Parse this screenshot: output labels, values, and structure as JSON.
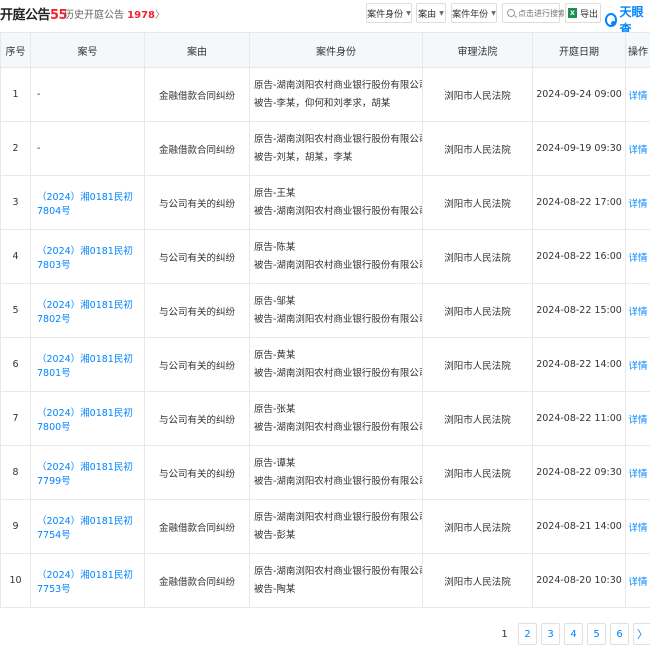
{
  "header": {
    "title": "开庭公告",
    "title_count": "55",
    "history_label": "历史开庭公告",
    "history_count": "1978",
    "history_arrow": "〉"
  },
  "filters": {
    "case_role": "案件身份",
    "cause": "案由",
    "year": "案件年份",
    "search_placeholder": "点击进行搜索",
    "export_label": "导出",
    "brand": "天眼查"
  },
  "table": {
    "columns": [
      "序号",
      "案号",
      "案由",
      "案件身份",
      "审理法院",
      "开庭日期",
      "操作"
    ],
    "rows": [
      {
        "no": "1",
        "case": "-",
        "cause": "金融借款合同纠纷",
        "plaintiff": "原告-湖南浏阳农村商业银行股份有限公司",
        "defendant": "被告-李某，仰何和刘孝求，胡某",
        "court": "浏阳市人民法院",
        "date": "2024-09-24 09:00",
        "action": "详情"
      },
      {
        "no": "2",
        "case": "-",
        "cause": "金融借款合同纠纷",
        "plaintiff": "原告-湖南浏阳农村商业银行股份有限公司",
        "defendant": "被告-刘某，胡某，李某",
        "court": "浏阳市人民法院",
        "date": "2024-09-19 09:30",
        "action": "详情"
      },
      {
        "no": "3",
        "case": "（2024）湘0181民初7804号",
        "cause": "与公司有关的纠纷",
        "plaintiff": "原告-王某",
        "defendant": "被告-湖南浏阳农村商业银行股份有限公司",
        "court": "浏阳市人民法院",
        "date": "2024-08-22 17:00",
        "action": "详情"
      },
      {
        "no": "4",
        "case": "（2024）湘0181民初7803号",
        "cause": "与公司有关的纠纷",
        "plaintiff": "原告-陈某",
        "defendant": "被告-湖南浏阳农村商业银行股份有限公司",
        "court": "浏阳市人民法院",
        "date": "2024-08-22 16:00",
        "action": "详情"
      },
      {
        "no": "5",
        "case": "（2024）湘0181民初7802号",
        "cause": "与公司有关的纠纷",
        "plaintiff": "原告-邹某",
        "defendant": "被告-湖南浏阳农村商业银行股份有限公司",
        "court": "浏阳市人民法院",
        "date": "2024-08-22 15:00",
        "action": "详情"
      },
      {
        "no": "6",
        "case": "（2024）湘0181民初7801号",
        "cause": "与公司有关的纠纷",
        "plaintiff": "原告-黄某",
        "defendant": "被告-湖南浏阳农村商业银行股份有限公司",
        "court": "浏阳市人民法院",
        "date": "2024-08-22 14:00",
        "action": "详情"
      },
      {
        "no": "7",
        "case": "（2024）湘0181民初7800号",
        "cause": "与公司有关的纠纷",
        "plaintiff": "原告-张某",
        "defendant": "被告-湖南浏阳农村商业银行股份有限公司",
        "court": "浏阳市人民法院",
        "date": "2024-08-22 11:00",
        "action": "详情"
      },
      {
        "no": "8",
        "case": "（2024）湘0181民初7799号",
        "cause": "与公司有关的纠纷",
        "plaintiff": "原告-谭某",
        "defendant": "被告-湖南浏阳农村商业银行股份有限公司",
        "court": "浏阳市人民法院",
        "date": "2024-08-22 09:30",
        "action": "详情"
      },
      {
        "no": "9",
        "case": "（2024）湘0181民初7754号",
        "cause": "金融借款合同纠纷",
        "plaintiff": "原告-湖南浏阳农村商业银行股份有限公司",
        "defendant": "被告-彭某",
        "court": "浏阳市人民法院",
        "date": "2024-08-21 14:00",
        "action": "详情"
      },
      {
        "no": "10",
        "case": "（2024）湘0181民初7753号",
        "cause": "金融借款合同纠纷",
        "plaintiff": "原告-湖南浏阳农村商业银行股份有限公司",
        "defendant": "被告-陶某",
        "court": "浏阳市人民法院",
        "date": "2024-08-20 10:30",
        "action": "详情"
      }
    ]
  },
  "pagination": {
    "pages": [
      "1",
      "2",
      "3",
      "4",
      "5",
      "6"
    ],
    "current": "1",
    "next": "〉"
  }
}
